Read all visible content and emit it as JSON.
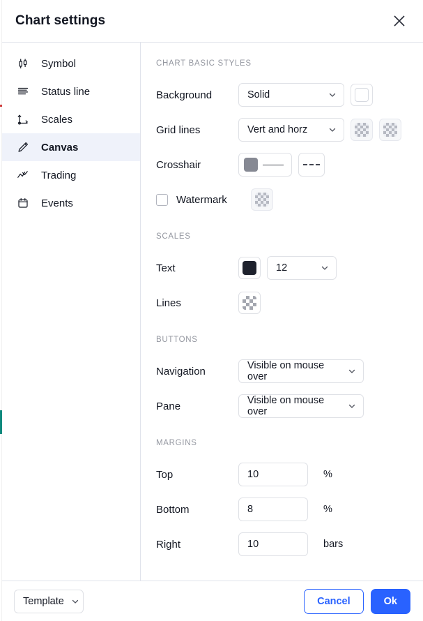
{
  "header": {
    "title": "Chart settings",
    "close_icon": "close-icon"
  },
  "sidebar": {
    "items": [
      {
        "label": "Symbol",
        "icon": "candlestick-icon",
        "active": false
      },
      {
        "label": "Status line",
        "icon": "status-line-icon",
        "active": false
      },
      {
        "label": "Scales",
        "icon": "axes-icon",
        "active": false
      },
      {
        "label": "Canvas",
        "icon": "pencil-icon",
        "active": true
      },
      {
        "label": "Trading",
        "icon": "trading-icon",
        "active": false
      },
      {
        "label": "Events",
        "icon": "calendar-icon",
        "active": false
      }
    ]
  },
  "sections": {
    "basic_styles": {
      "title": "Chart basic styles",
      "background": {
        "label": "Background",
        "type_value": "Solid",
        "swatch_color": "#ffffff"
      },
      "grid_lines": {
        "label": "Grid lines",
        "type_value": "Vert and horz",
        "swatch_vert": "transparent",
        "swatch_horz": "transparent"
      },
      "crosshair": {
        "label": "Crosshair",
        "swatch_color": "#868993",
        "line_style": "solid",
        "dash_style": "dashed"
      },
      "watermark": {
        "label": "Watermark",
        "checked": false,
        "swatch_color": "transparent"
      }
    },
    "scales": {
      "title": "Scales",
      "text": {
        "label": "Text",
        "swatch_color": "#1e222d",
        "font_size": "12"
      },
      "lines": {
        "label": "Lines",
        "swatch_color": "transparent"
      }
    },
    "buttons": {
      "title": "Buttons",
      "navigation": {
        "label": "Navigation",
        "value": "Visible on mouse over"
      },
      "pane": {
        "label": "Pane",
        "value": "Visible on mouse over"
      }
    },
    "margins": {
      "title": "Margins",
      "top": {
        "label": "Top",
        "value": "10",
        "unit": "%"
      },
      "bottom": {
        "label": "Bottom",
        "value": "8",
        "unit": "%"
      },
      "right": {
        "label": "Right",
        "value": "10",
        "unit": "bars"
      }
    }
  },
  "footer": {
    "template_label": "Template",
    "cancel_label": "Cancel",
    "ok_label": "Ok"
  },
  "colors": {
    "accent": "#2962ff",
    "active_row": "#eff2fa",
    "border": "#e0e3eb",
    "muted_text": "#9598a1"
  }
}
